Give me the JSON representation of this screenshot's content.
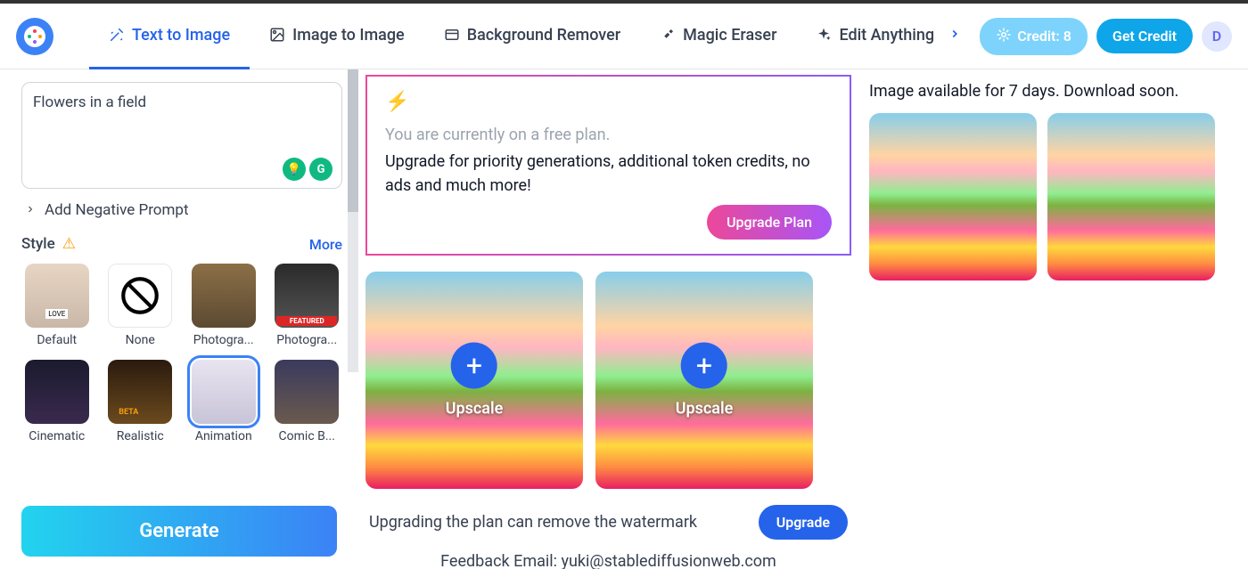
{
  "header": {
    "nav": [
      {
        "label": "Text to Image",
        "icon": "wand"
      },
      {
        "label": "Image to Image",
        "icon": "image"
      },
      {
        "label": "Background Remover",
        "icon": "eraser-bg"
      },
      {
        "label": "Magic Eraser",
        "icon": "brush"
      },
      {
        "label": "Edit Anything",
        "icon": "sparkle"
      }
    ],
    "credit_label": "Credit: 8",
    "get_credit_label": "Get Credit",
    "avatar_initial": "D"
  },
  "sidebar": {
    "prompt_value": "Flowers in a field",
    "negative_prompt_label": "Add Negative Prompt",
    "style_label": "Style",
    "more_label": "More",
    "styles": [
      {
        "name": "Default"
      },
      {
        "name": "None"
      },
      {
        "name": "Photogra..."
      },
      {
        "name": "Photogra..."
      },
      {
        "name": "Cinematic"
      },
      {
        "name": "Realistic"
      },
      {
        "name": "Animation"
      },
      {
        "name": "Comic B..."
      }
    ],
    "selected_style_index": 6,
    "generate_label": "Generate"
  },
  "center": {
    "free_plan_text": "You are currently on a free plan.",
    "upgrade_desc": "Upgrade for priority generations, additional token credits, no ads and much more!",
    "upgrade_plan_label": "Upgrade Plan",
    "upscale_label": "Upscale",
    "watermark_text": "Upgrading the plan can remove the watermark",
    "upgrade_label": "Upgrade",
    "feedback_text": "Feedback Email: yuki@stablediffusionweb.com"
  },
  "right": {
    "available_text": "Image available for 7 days. Download soon."
  }
}
